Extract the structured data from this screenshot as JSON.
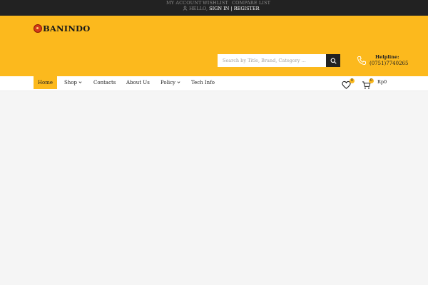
{
  "topbar": {
    "links": {
      "account": "MY ACCOUNT",
      "wishlist": "WISHLIST",
      "compare": "COMPARE LIST"
    },
    "greeting": "HELLO,",
    "sign_in": "SIGN IN",
    "separator": " | ",
    "register": "REGISTER",
    "user_icon": "user-icon"
  },
  "header": {
    "logo_text": "BANINDO",
    "search": {
      "placeholder": "Search by Title, Brand, Category ...",
      "icon": "search-icon"
    },
    "helpline": {
      "label": "Helpline:",
      "number": "(0751)7740265",
      "icon": "phone-icon"
    }
  },
  "nav": {
    "items": [
      {
        "label": "Home",
        "active": true
      },
      {
        "label": "Shop",
        "has_dropdown": true
      },
      {
        "label": "Contacts"
      },
      {
        "label": "About Us"
      },
      {
        "label": "Policy",
        "has_dropdown": true
      },
      {
        "label": "Tech Info"
      }
    ]
  },
  "actions": {
    "wishlist_count": "0",
    "cart_count": "0",
    "cart_total": "Rp0"
  },
  "colors": {
    "brand": "#fcb91d",
    "dark": "#222222",
    "background": "#f5f5f5"
  }
}
